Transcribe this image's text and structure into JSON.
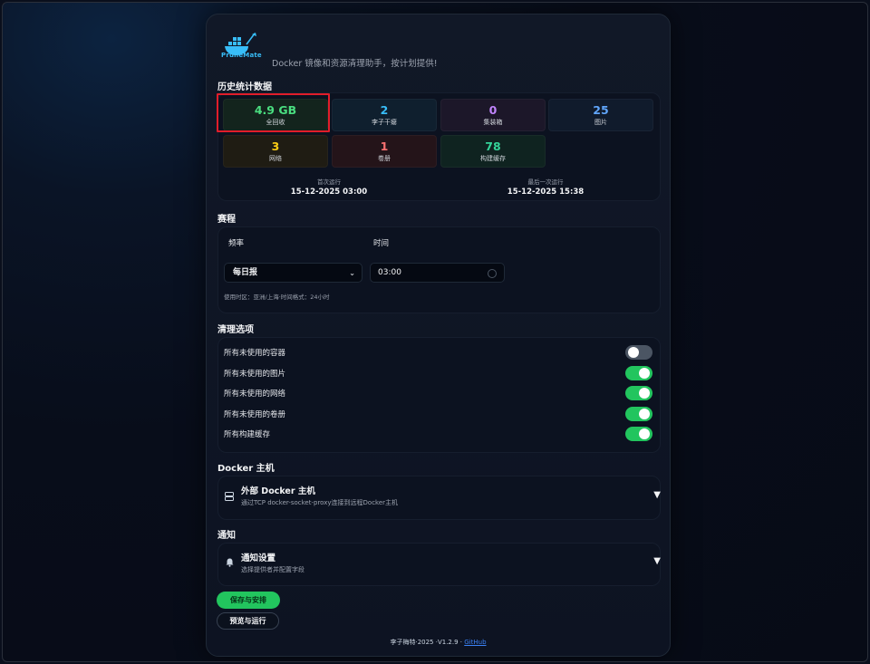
{
  "app": {
    "logo_text": "PruneMate",
    "subtitle": "Docker 镜像和资源清理助手，按计划提供!"
  },
  "stats": {
    "title": "历史统计数据",
    "items": [
      {
        "value": "4.9 GB",
        "label": "全回收",
        "color": "#4ade80",
        "bg": "#13241d"
      },
      {
        "value": "2",
        "label": "李子干瘪",
        "color": "#38bdf8",
        "bg": "#0f1f2e"
      },
      {
        "value": "0",
        "label": "集装箱",
        "color": "#c084fc",
        "bg": "#1c1729"
      },
      {
        "value": "25",
        "label": "图片",
        "color": "#60a5fa",
        "bg": "#101b2c"
      },
      {
        "value": "3",
        "label": "网络",
        "color": "#facc15",
        "bg": "#1f1c13"
      },
      {
        "value": "1",
        "label": "卷册",
        "color": "#f87171",
        "bg": "#241419"
      },
      {
        "value": "78",
        "label": "构建缓存",
        "color": "#34d399",
        "bg": "#0f2320"
      }
    ],
    "first_run_label": "首次运行",
    "first_run_value": "15-12-2025 03:00",
    "last_run_label": "最后一次运行",
    "last_run_value": "15-12-2025 15:38"
  },
  "schedule": {
    "title": "赛程",
    "frequency_label": "频率",
    "time_label": "时间",
    "frequency_value": "每日报",
    "time_value": "03:00",
    "tz_note": "使用时区：亚洲/上海·时间格式：24小时"
  },
  "cleanup": {
    "title": "清理选项",
    "options": [
      {
        "label": "所有未使用的容器",
        "enabled": false
      },
      {
        "label": "所有未使用的图片",
        "enabled": true
      },
      {
        "label": "所有未使用的网络",
        "enabled": true
      },
      {
        "label": "所有未使用的卷册",
        "enabled": true
      },
      {
        "label": "所有构建缓存",
        "enabled": true
      }
    ]
  },
  "docker_host": {
    "title": "Docker 主机",
    "panel_title": "外部 Docker 主机",
    "panel_sub": "通过TCP docker-socket-proxy连接到远程Docker主机"
  },
  "notifications": {
    "title": "通知",
    "panel_title": "通知设置",
    "panel_sub": "选择提供者并配置字段"
  },
  "actions": {
    "save_label": "保存与安排",
    "preview_label": "预览与运行"
  },
  "footer": {
    "text": "李子梅特·2025 ·V1.2.9 ·",
    "link": "GitHub"
  },
  "colors": {
    "accent_green": "#22c55e",
    "highlight_red": "#e11d2a"
  }
}
